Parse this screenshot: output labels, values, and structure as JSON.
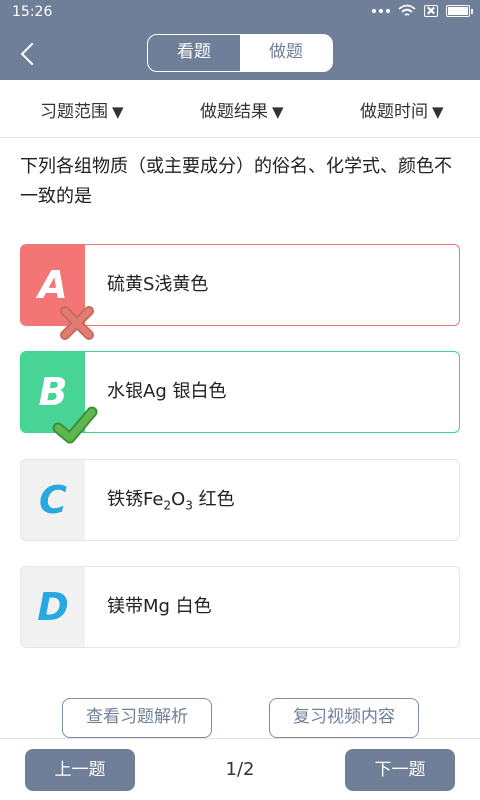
{
  "status_bar": {
    "time": "15:26"
  },
  "header": {
    "tabs": [
      {
        "label": "看题"
      },
      {
        "label": "做题"
      }
    ]
  },
  "filters": [
    {
      "label": "习题范围",
      "arrow": "▼"
    },
    {
      "label": "做题结果",
      "arrow": "▼"
    },
    {
      "label": "做题时间",
      "arrow": "▼"
    }
  ],
  "question": {
    "text": "下列各组物质（或主要成分）的俗名、化学式、颜色不一致的是"
  },
  "options": [
    {
      "letter": "A",
      "text": "硫黄S浅黄色",
      "state": "wrong"
    },
    {
      "letter": "B",
      "text": "水银Ag 银白色",
      "state": "correct"
    },
    {
      "letter": "C",
      "text_pre": "铁锈Fe",
      "sub1": "2",
      "text_mid": "O",
      "sub2": "3",
      "text_post": " 红色",
      "state": "none"
    },
    {
      "letter": "D",
      "text": "镁带Mg 白色",
      "state": "none"
    }
  ],
  "actions": {
    "analysis_label": "查看习题解析",
    "video_label": "复习视频内容"
  },
  "footer": {
    "prev_label": "上一题",
    "next_label": "下一题",
    "page": "1/2"
  },
  "colors": {
    "header_bg": "#6f7f99",
    "wrong": "#f47575",
    "correct": "#48d494",
    "letter_blue": "#27a8e0"
  },
  "icons": {
    "back": "chevron-left-icon",
    "wrong_mark": "cross-icon",
    "correct_mark": "check-icon"
  }
}
